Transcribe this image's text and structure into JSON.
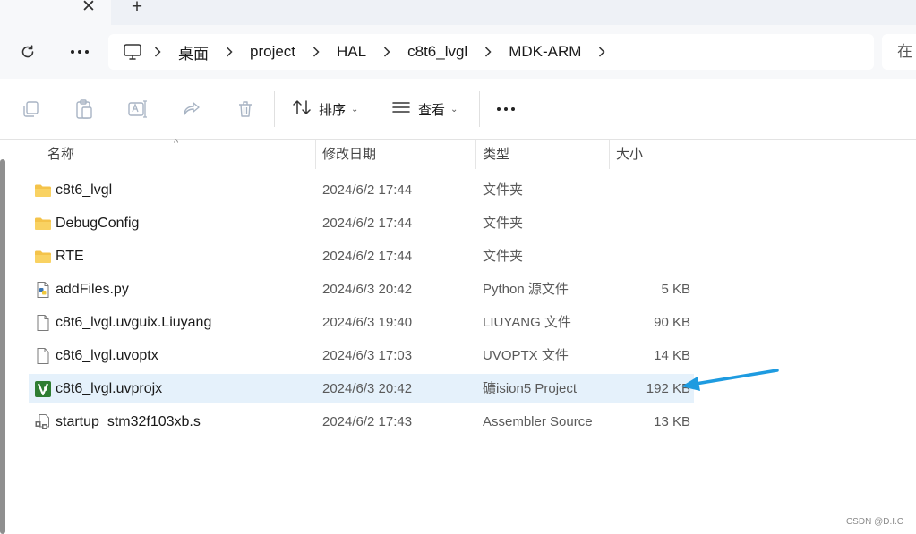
{
  "tabs": {
    "close_glyph": "✕",
    "new_tab_glyph": "+"
  },
  "nav": {
    "refresh_icon": "refresh-icon",
    "more_icon": "more-horizontal-icon",
    "breadcrumb": [
      "桌面",
      "project",
      "HAL",
      "c8t6_lvgl",
      "MDK-ARM"
    ],
    "search_placeholder": "在"
  },
  "command_bar": {
    "sort_label": "排序",
    "view_label": "查看",
    "more_glyph": "•••"
  },
  "file_list": {
    "columns": {
      "name": "名称",
      "date": "修改日期",
      "type": "类型",
      "size": "大小"
    },
    "rows": [
      {
        "icon": "folder-icon",
        "name": "c8t6_lvgl",
        "date": "2024/6/2 17:44",
        "type": "文件夹",
        "size": ""
      },
      {
        "icon": "folder-icon",
        "name": "DebugConfig",
        "date": "2024/6/2 17:44",
        "type": "文件夹",
        "size": ""
      },
      {
        "icon": "folder-icon",
        "name": "RTE",
        "date": "2024/6/2 17:44",
        "type": "文件夹",
        "size": ""
      },
      {
        "icon": "python-file-icon",
        "name": "addFiles.py",
        "date": "2024/6/3 20:42",
        "type": "Python 源文件",
        "size": "5 KB"
      },
      {
        "icon": "blank-file-icon",
        "name": "c8t6_lvgl.uvguix.Liuyang",
        "date": "2024/6/3 19:40",
        "type": "LIUYANG 文件",
        "size": "90 KB"
      },
      {
        "icon": "blank-file-icon",
        "name": "c8t6_lvgl.uvoptx",
        "date": "2024/6/3 17:03",
        "type": "UVOPTX 文件",
        "size": "14 KB"
      },
      {
        "icon": "keil-project-icon",
        "name": "c8t6_lvgl.uvprojx",
        "date": "2024/6/3 20:42",
        "type": "礦ision5 Project",
        "size": "192 KB",
        "selected": true
      },
      {
        "icon": "assembler-file-icon",
        "name": "startup_stm32f103xb.s",
        "date": "2024/6/2 17:43",
        "type": "Assembler Source",
        "size": "13 KB"
      }
    ]
  },
  "annotation": {
    "arrow_color": "#1e9be0"
  },
  "watermark": "CSDN @D.I.C",
  "colors": {
    "selection": "#e5f1fb",
    "folder": "#f4c34a",
    "keil_green": "#2f7d32"
  }
}
